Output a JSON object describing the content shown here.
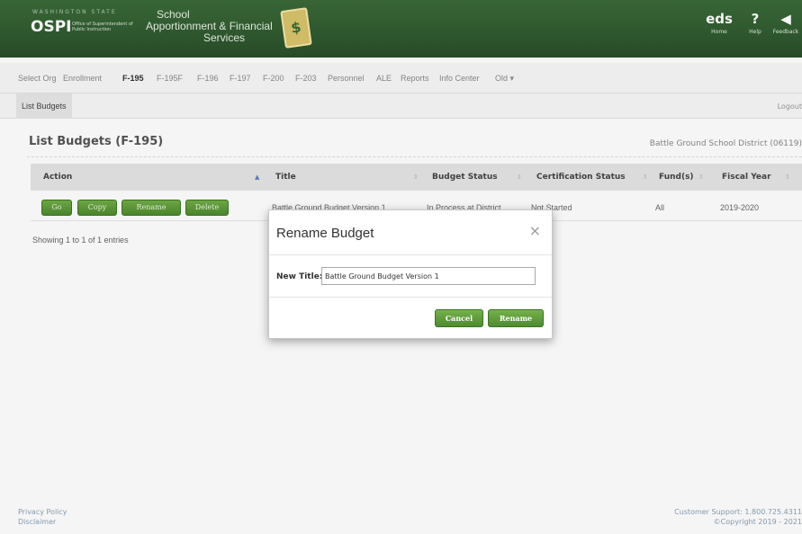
{
  "header": {
    "state_label": "WASHINGTON STATE",
    "org_short": "OSPI",
    "org_long": "Office of Superintendent of Public Instruction",
    "app_title_line1": "School",
    "app_title_line2": "Apportionment & Financial",
    "app_title_line3": "Services",
    "logo_glyph": "$",
    "icons": [
      {
        "name": "eds-home-icon",
        "glyph": "eds",
        "label": "Home"
      },
      {
        "name": "help-icon",
        "glyph": "?",
        "label": "Help"
      },
      {
        "name": "feedback-icon",
        "glyph": "◀",
        "label": "Feedback"
      }
    ]
  },
  "nav": {
    "items": [
      "Select Org",
      "Enrollment",
      "F-195",
      "F-195F",
      "F-196",
      "F-197",
      "F-200",
      "F-203",
      "Personnel",
      "ALE",
      "Reports",
      "Info Center",
      "Old ▾"
    ],
    "active": "F-195"
  },
  "subnav": {
    "tab": "List Budgets",
    "logout": "Logout"
  },
  "page": {
    "title": "List Budgets (F-195)",
    "district": "Battle Ground School District (06119)"
  },
  "table": {
    "headers": [
      "Action",
      "Title",
      "Budget Status",
      "Certification Status",
      "Fund(s)",
      "Fiscal Year"
    ],
    "actions": [
      "Go",
      "Copy",
      "Rename",
      "Delete"
    ],
    "rows": [
      {
        "title": "Battle Ground Budget Version 1",
        "status": "In Process at District",
        "certification": "Not Started",
        "funds": "All",
        "fiscal_year": "2019-2020"
      }
    ],
    "entries_text": "Showing 1 to 1 of 1 entries"
  },
  "modal": {
    "title": "Rename Budget",
    "close_glyph": "×",
    "field_label": "New Title:",
    "field_value": "Battle Ground Budget Version 1",
    "cancel_label": "Cancel",
    "rename_label": "Rename"
  },
  "footer": {
    "privacy": "Privacy Policy",
    "disclaimer": "Disclaimer",
    "support": "Customer Support: 1.800.725.4311",
    "copyright": "©Copyright 2019 - 2021"
  },
  "colors": {
    "header_green": "#2f5a2f",
    "button_green": "#5f9a3c"
  }
}
